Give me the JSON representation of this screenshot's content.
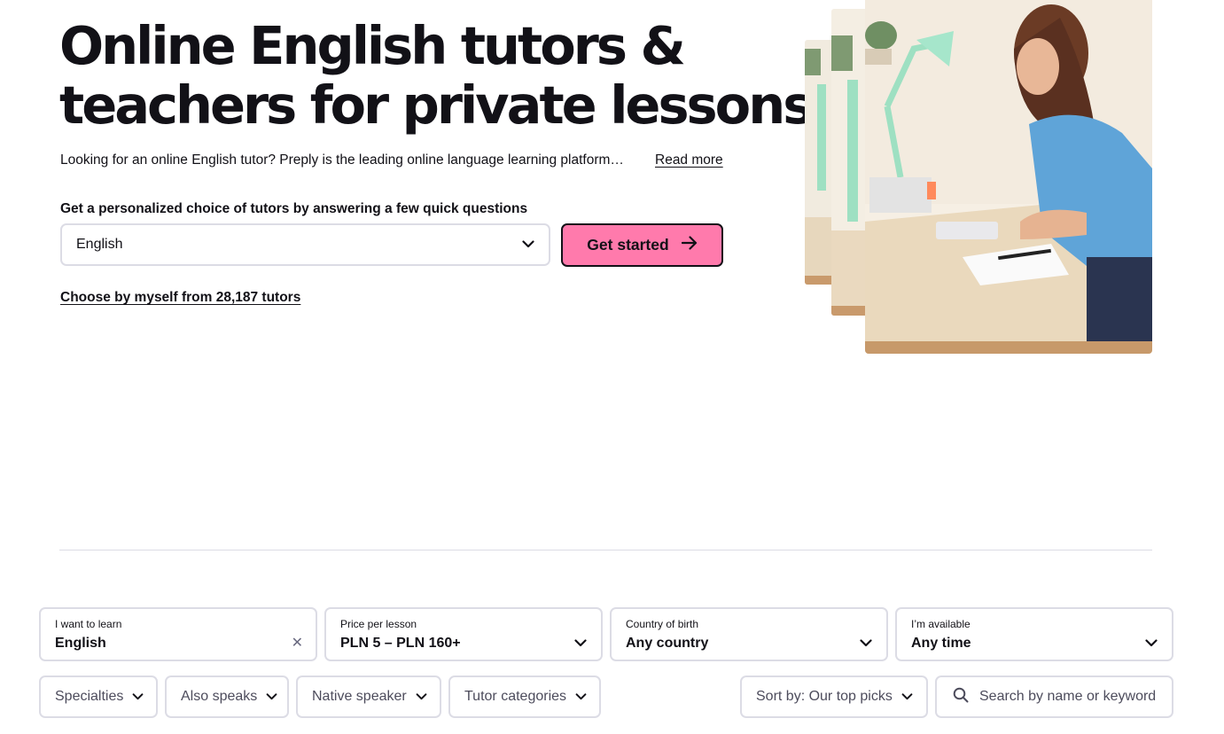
{
  "hero": {
    "title_line1": "Online English tutors &",
    "title_line2": "teachers for private lessons",
    "subtitle": "Looking for an online English tutor? Preply is the leading online language learning platform…",
    "read_more": "Read more"
  },
  "quiz": {
    "label": "Get a personalized choice of tutors by answering a few quick questions",
    "language_value": "English",
    "cta_label": "Get started"
  },
  "choose_link": "Choose by myself from 28,187 tutors",
  "filters": [
    {
      "label": "I want to learn",
      "value": "English"
    },
    {
      "label": "Price per lesson",
      "value": "PLN 5 – PLN 160+"
    },
    {
      "label": "Country of birth",
      "value": "Any country"
    },
    {
      "label": "I’m available",
      "value": "Any time"
    }
  ],
  "chips": {
    "specialties": "Specialties",
    "also_speaks": "Also speaks",
    "native_speaker": "Native speaker",
    "tutor_categories": "Tutor categories",
    "sort": "Sort by: Our top picks"
  },
  "search": {
    "placeholder": "Search by name or keyword"
  },
  "colors": {
    "accent_pink": "#ff7aac",
    "text": "#121117",
    "border": "#dcdce5"
  },
  "icons": {
    "dropdown": "chevron-down-icon",
    "cta": "arrow-right-icon",
    "clear": "close-icon",
    "search": "search-icon"
  }
}
